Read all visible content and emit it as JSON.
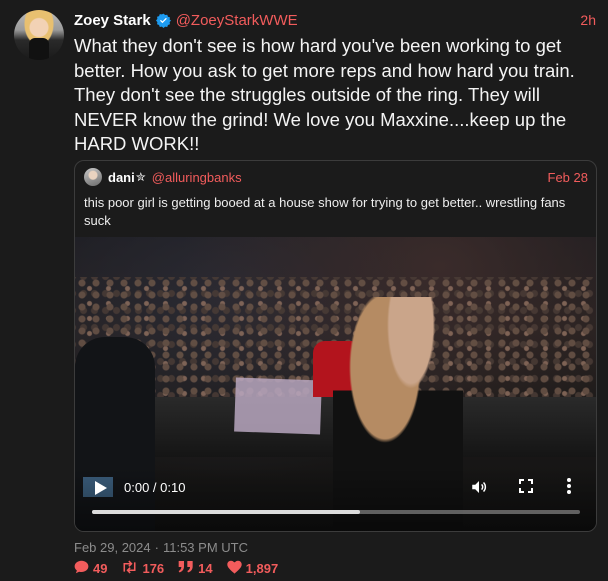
{
  "tweet": {
    "author_name": "Zoey Stark",
    "author_handle": "@ZoeyStarkWWE",
    "time": "2h",
    "text": "What they don't see is how hard you've been working to get better. How you ask to get more reps and how hard you train. They don't see the struggles outside of the ring. They will NEVER know the grind! We love you Maxxine....keep up the HARD WORK!!",
    "date": "Feb 29, 2024",
    "clock": "11:53 PM UTC",
    "separator": "·"
  },
  "quote": {
    "author_name": "dani",
    "star": "✮",
    "author_handle": "@alluringbanks",
    "time": "Feb 28",
    "text": "this poor girl is getting booed at a house show for trying to get better.. wrestling fans suck"
  },
  "video": {
    "time_display": "0:00 / 0:10",
    "progress": 0.55
  },
  "stats": {
    "replies": "49",
    "retweets": "176",
    "quotes": "14",
    "likes": "1,897"
  },
  "colors": {
    "accent": "#f25c5c",
    "background": "#1b1b1b",
    "verified": "#1d9bf0"
  },
  "icons": [
    "verified-badge-icon",
    "play-icon",
    "volume-icon",
    "fullscreen-icon",
    "more-options-icon",
    "reply-icon",
    "retweet-icon",
    "quote-icon",
    "heart-icon"
  ]
}
